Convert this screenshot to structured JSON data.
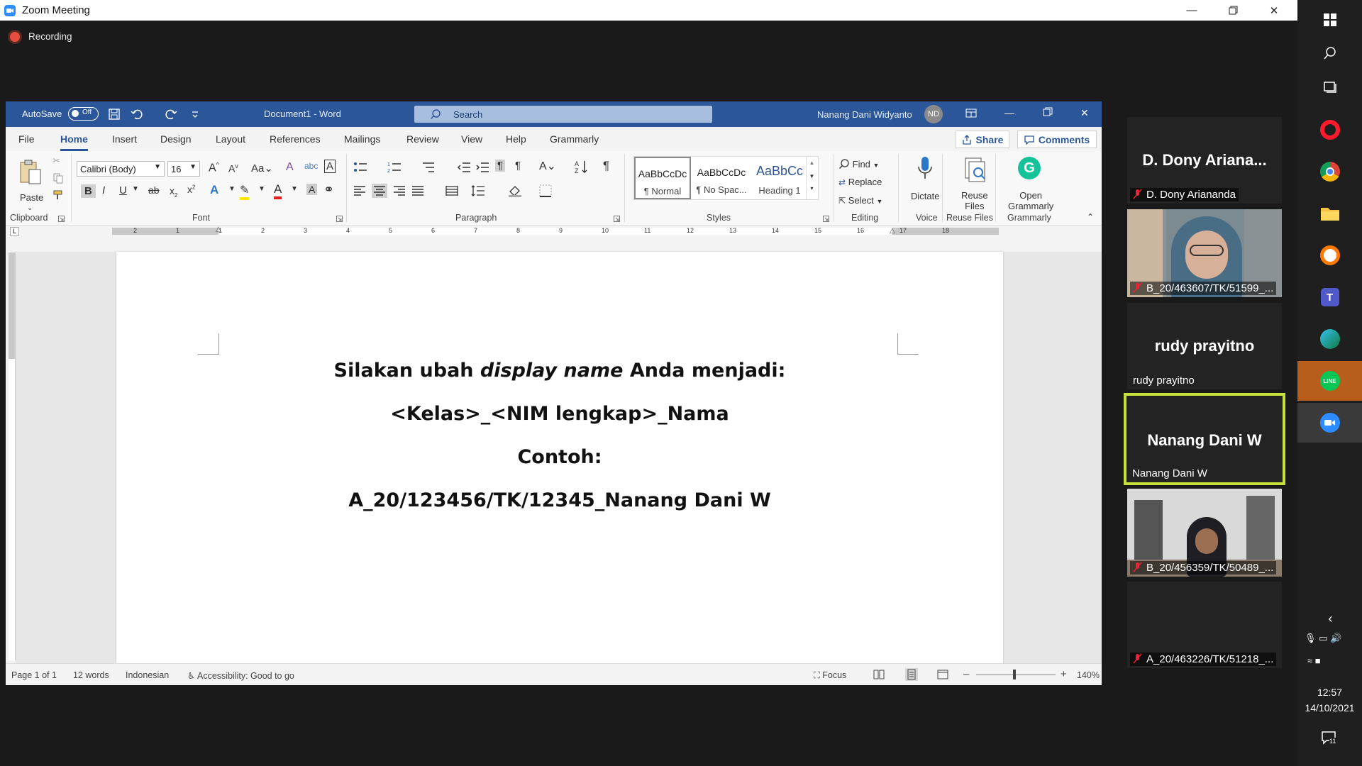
{
  "zoom": {
    "window_title": "Zoom Meeting",
    "recording_label": "Recording"
  },
  "word": {
    "autosave_label": "AutoSave",
    "autosave_state": "Off",
    "doc_title": "Document1  -  Word",
    "search_placeholder": "Search",
    "user_name": "Nanang Dani Widyanto",
    "user_initials": "ND",
    "menu": [
      "File",
      "Home",
      "Insert",
      "Design",
      "Layout",
      "References",
      "Mailings",
      "Review",
      "View",
      "Help",
      "Grammarly"
    ],
    "share_label": "Share",
    "comments_label": "Comments",
    "ribbon": {
      "paste_label": "Paste",
      "clipboard_label": "Clipboard",
      "font_name": "Calibri (Body)",
      "font_size": "16",
      "font_label": "Font",
      "paragraph_label": "Paragraph",
      "styles": [
        {
          "preview": "AaBbCcDc",
          "name": "¶ Normal"
        },
        {
          "preview": "AaBbCcDc",
          "name": "¶ No Spac..."
        },
        {
          "preview": "AaBbCc",
          "name": "Heading 1"
        }
      ],
      "styles_label": "Styles",
      "find_label": "Find",
      "replace_label": "Replace",
      "select_label": "Select",
      "editing_label": "Editing",
      "dictate_label": "Dictate",
      "voice_label": "Voice",
      "reuse_files_label": "Reuse\nFiles",
      "reuse_files_group": "Reuse Files",
      "open_grammarly_label": "Open\nGrammarly",
      "grammarly_group": "Grammarly"
    },
    "document": {
      "line1_a": "Silakan ubah ",
      "line1_b": "display name",
      "line1_c": " Anda menjadi:",
      "line2": "<Kelas>_<NIM lengkap>_Nama",
      "line3": "Contoh:",
      "line4": "A_20/123456/TK/12345_Nanang Dani W"
    },
    "status": {
      "page": "Page 1 of 1",
      "words": "12 words",
      "language": "Indonesian",
      "accessibility": "Accessibility: Good to go",
      "focus": "Focus",
      "zoom": "140%"
    },
    "ruler_numbers": [
      "2",
      "1",
      "1",
      "2",
      "3",
      "4",
      "5",
      "6",
      "7",
      "8",
      "9",
      "10",
      "11",
      "12",
      "13",
      "14",
      "15",
      "16",
      "17",
      "18"
    ]
  },
  "participants": [
    {
      "big": "D. Dony Ariana...",
      "name": "D. Dony Ariananda",
      "muted": true,
      "video": false
    },
    {
      "big": "",
      "name": "B_20/463607/TK/51599_...",
      "muted": true,
      "video": true
    },
    {
      "big": "rudy prayitno",
      "name": "rudy prayitno",
      "muted": false,
      "video": false
    },
    {
      "big": "Nanang Dani W",
      "name": "Nanang Dani W",
      "muted": false,
      "video": false,
      "active": true
    },
    {
      "big": "",
      "name": "B_20/456359/TK/50489_...",
      "muted": true,
      "video": true
    },
    {
      "big": "",
      "name": "A_20/463226/TK/51218_...",
      "muted": true,
      "video": false
    }
  ],
  "taskbar": {
    "time": "12:57",
    "date": "14/10/2021",
    "notifications": "11"
  },
  "colors": {
    "word_blue": "#2b579a",
    "active_speaker": "#c6e23a",
    "recording": "#e74c3c"
  }
}
